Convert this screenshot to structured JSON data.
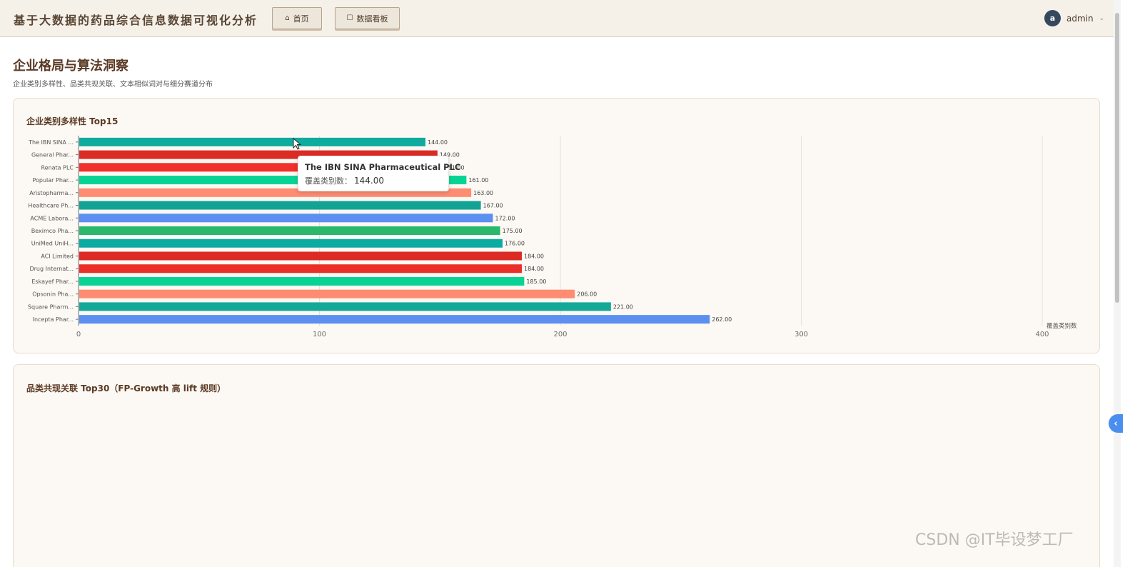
{
  "app": {
    "title": "基于大数据的药品综合信息数据可视化分析",
    "tabs": [
      {
        "label": "首页",
        "icon": "home-icon"
      },
      {
        "label": "数据看板",
        "icon": "dashboard-icon"
      }
    ],
    "user": {
      "initial": "a",
      "name": "admin"
    }
  },
  "page": {
    "title": "企业格局与算法洞察",
    "subtitle": "企业类别多样性、品类共现关联、文本相似词对与细分赛道分布"
  },
  "cards": {
    "diversity_title": "企业类别多样性 Top15",
    "cooccur_title": "品类共现关联 Top30（FP-Growth 高 lift 规则）"
  },
  "tooltip": {
    "title": "The IBN SINA Pharmaceutical PLC",
    "label": "覆盖类别数：",
    "value": "144.00"
  },
  "watermark": "CSDN @IT毕设梦工厂",
  "colors": {
    "accent": "#5a3a24",
    "teal": "#0fab9e",
    "red": "#dc2b25",
    "green": "#07d494",
    "salmon": "#fd8c71",
    "blue": "#5c8ff0",
    "emerald": "#2ab96b"
  },
  "chart_data": {
    "type": "bar",
    "orientation": "horizontal",
    "xlabel": "覆盖类别数",
    "xlim": [
      0,
      400
    ],
    "xticks": [
      0,
      100,
      200,
      300,
      400
    ],
    "grid": true,
    "categories": [
      "The IBN SINA ...",
      "General Phar...",
      "Renata PLC",
      "Popular Phar...",
      "Aristopharma...",
      "Healthcare Ph...",
      "ACME Labora...",
      "Beximco Pha...",
      "UniMed UniH...",
      "ACI Limited",
      "Drug Internat...",
      "Eskayef Phar...",
      "Opsonin Pha...",
      "Square Pharm...",
      "Incepta Phar..."
    ],
    "values": [
      144,
      149,
      151,
      161,
      163,
      167,
      172,
      175,
      176,
      184,
      184,
      185,
      206,
      221,
      262
    ],
    "value_labels": [
      "144.00",
      "149.00",
      "151.00",
      "161.00",
      "163.00",
      "167.00",
      "172.00",
      "175.00",
      "176.00",
      "184.00",
      "184.00",
      "185.00",
      "206.00",
      "221.00",
      "262.00"
    ],
    "bar_colors": [
      "#0fab9e",
      "#dc2b25",
      "#f0302a",
      "#07d494",
      "#fd8c71",
      "#12a394",
      "#5c8ff0",
      "#2ab96b",
      "#0aaba0",
      "#dc2b25",
      "#ea2f28",
      "#07d494",
      "#fd8c71",
      "#14a898",
      "#5c8ff0"
    ]
  }
}
